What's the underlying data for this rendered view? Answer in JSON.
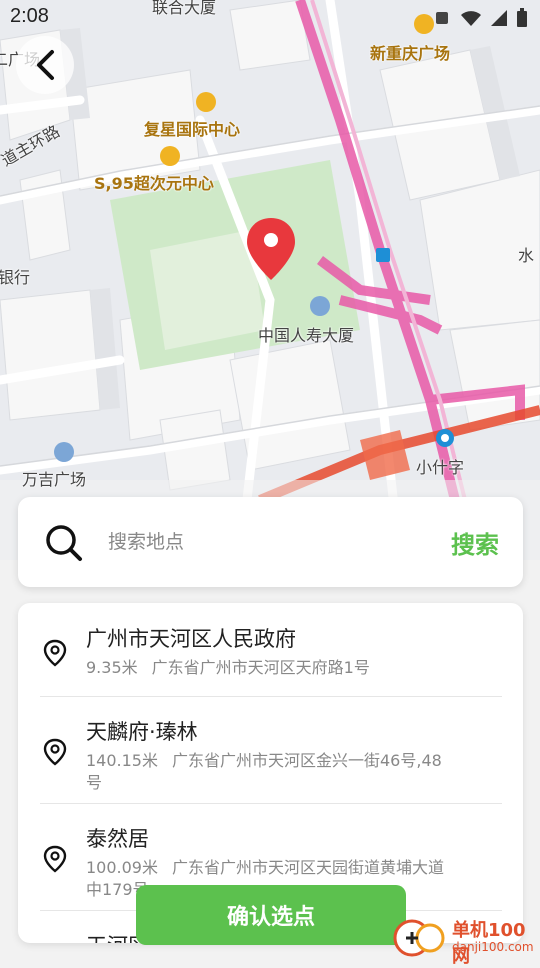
{
  "status": {
    "time": "2:08"
  },
  "map": {
    "labels": {
      "lianhe": "联合大厦",
      "xinchongqing": "新重庆广场",
      "fuxing": "复星国际中心",
      "s95": "S,95超次元中心",
      "road": "道主环路",
      "bank": "银行",
      "renshou": "中国人寿大厦",
      "wanji": "万吉广场",
      "xiaoshizi": "小什字",
      "guangchang_left": "二广场",
      "water": "水"
    },
    "pin_color": "#e8383d",
    "metro_color": "#e85aa8"
  },
  "search": {
    "placeholder": "搜索地点",
    "button": "搜索"
  },
  "results": [
    {
      "name": "广州市天河区人民政府",
      "distance": "9.35米",
      "address": "广东省广州市天河区天府路1号"
    },
    {
      "name": "天麟府·瑧林",
      "distance": "140.15米",
      "address": "广东省广州市天河区金兴一街46号,48号"
    },
    {
      "name": "泰然居",
      "distance": "100.09米",
      "address": "广东省广州市天河区天园街道黄埔大道中179号"
    },
    {
      "name": "天河区",
      "distance": "",
      "address": ""
    }
  ],
  "confirm_label": "确认选点",
  "watermark": {
    "name": "单机100网",
    "url": "danji100.com"
  },
  "colors": {
    "accent": "#5cc14e"
  }
}
